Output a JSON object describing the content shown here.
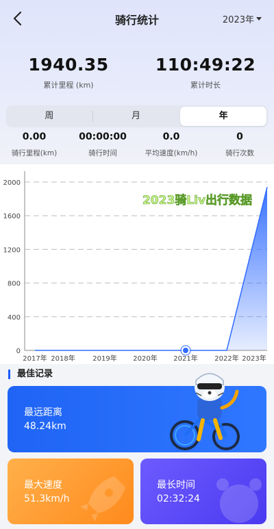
{
  "header": {
    "title": "骑行统计",
    "year_select": "2023年"
  },
  "summary": {
    "distance": {
      "value": "1940.35",
      "label": "累计里程 (km)"
    },
    "duration": {
      "value": "110:49:22",
      "label": "累计时长"
    }
  },
  "period_tabs": [
    {
      "label": "周",
      "active": false
    },
    {
      "label": "月",
      "active": false
    },
    {
      "label": "年",
      "active": true
    }
  ],
  "period_stats": [
    {
      "value": "0.00",
      "label": "骑行里程(km)"
    },
    {
      "value": "00:00:00",
      "label": "骑行时间"
    },
    {
      "value": "0.0",
      "label": "平均速度(km/h)"
    },
    {
      "value": "0",
      "label": "骑行次数"
    }
  ],
  "chart_data": {
    "type": "area",
    "watermark": "2023骑Liv出行数据",
    "categories": [
      "2017年",
      "2018年",
      "2019年",
      "2020年",
      "2021年",
      "2022年",
      "2023年"
    ],
    "values": [
      0,
      0,
      0,
      0,
      0,
      0,
      1940.35
    ],
    "selected_category": "2021年",
    "ylim": [
      0,
      2000
    ],
    "yticks": [
      0,
      400,
      800,
      1200,
      1600,
      2000
    ],
    "grid": true,
    "color": "#2f6bff"
  },
  "best_records": {
    "title": "最佳记录",
    "distance": {
      "label": "最远距离",
      "value": "48.24km"
    },
    "speed": {
      "label": "最大速度",
      "value": "51.3km/h"
    },
    "time": {
      "label": "最长时间",
      "value": "02:32:24"
    }
  },
  "icons": {
    "back": "back-arrow-icon",
    "caret": "caret-down-icon"
  }
}
